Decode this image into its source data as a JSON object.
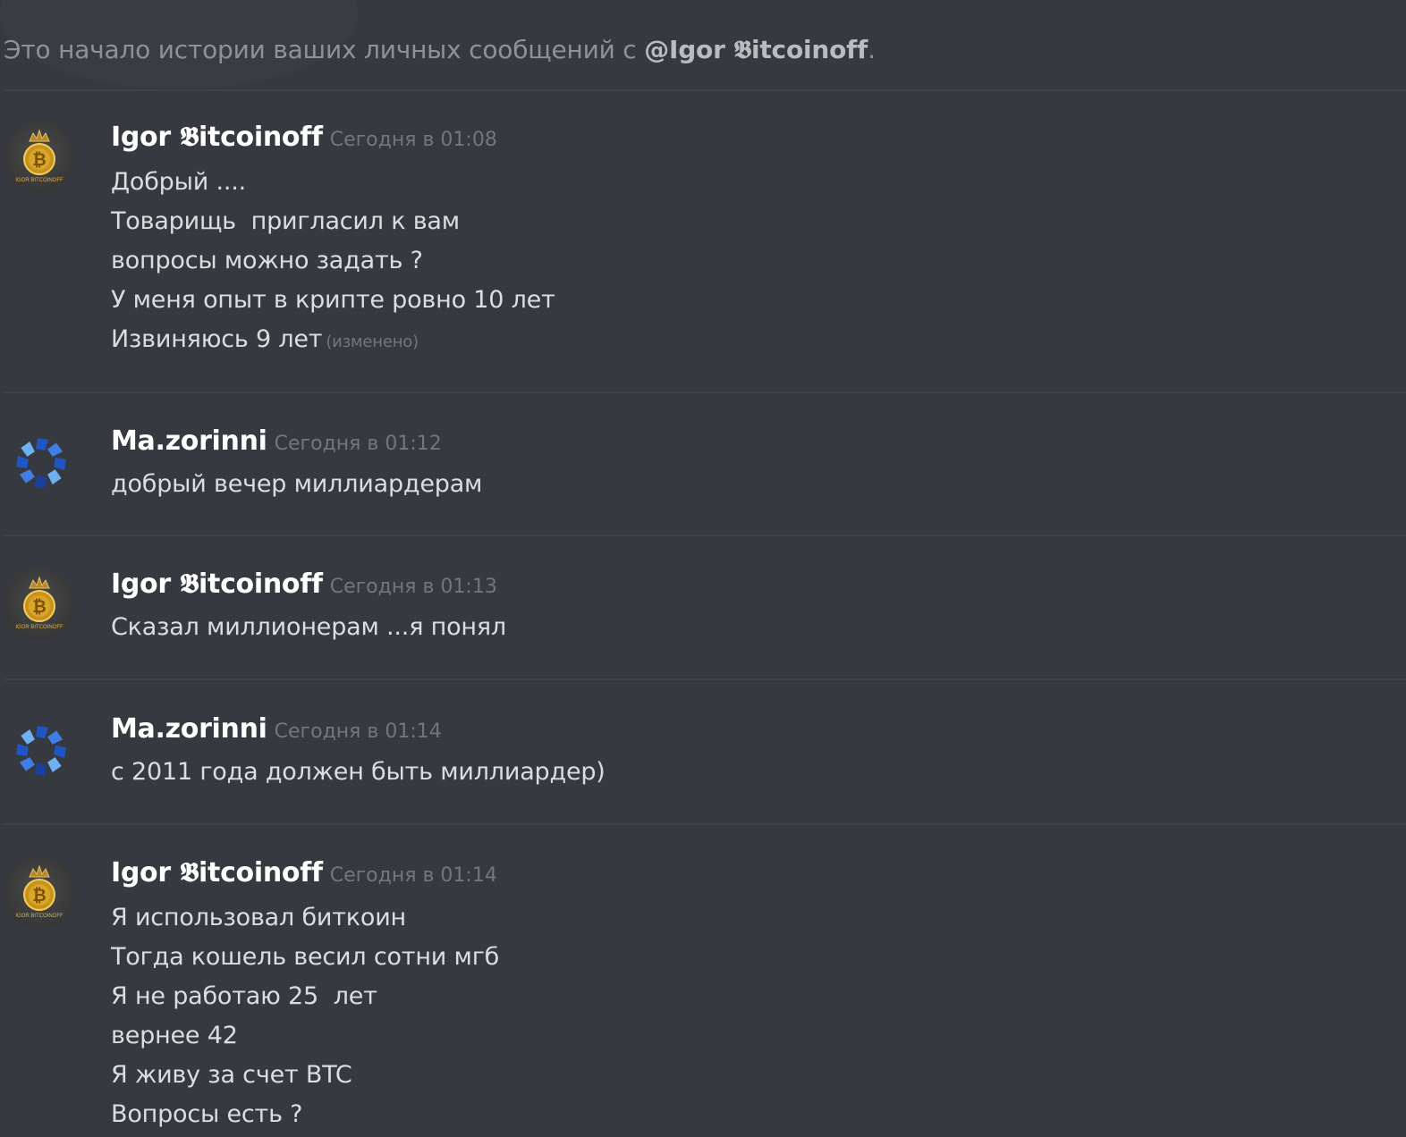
{
  "intro": {
    "text": "Это начало истории ваших личных сообщений с ",
    "mention": "@Igor 𝕭itcoinoff",
    "end": "."
  },
  "messages": [
    {
      "author": "Igor 𝕭itcoinoff",
      "time": "Сегодня в 01:08",
      "avatar": "bitcoin-crown-icon",
      "lines": [
        "Добрый ....",
        "Товарищь  пригласил к вам",
        "вопросы можно задать ?",
        "У меня опыт в крипте ровно 10 лет",
        "Извиняюсь 9 лет"
      ],
      "edited_label": "(изменено)"
    },
    {
      "author": "Ma.zorinni",
      "time": "Сегодня в 01:12",
      "avatar": "blue-star-icon",
      "lines": [
        "добрый вечер миллиардерам"
      ]
    },
    {
      "author": "Igor 𝕭itcoinoff",
      "time": "Сегодня в 01:13",
      "avatar": "bitcoin-crown-icon",
      "lines": [
        "Сказал миллионерам ...я понял"
      ]
    },
    {
      "author": "Ma.zorinni",
      "time": "Сегодня в 01:14",
      "avatar": "blue-star-icon",
      "lines": [
        "с 2011 года должен быть миллиардер)"
      ]
    },
    {
      "author": "Igor 𝕭itcoinoff",
      "time": "Сегодня в 01:14",
      "avatar": "bitcoin-crown-icon",
      "lines": [
        "Я использовал биткоин",
        "Тогда кошель весил сотни мгб",
        "Я не работаю 25  лет",
        "вернее 42",
        "Я живу за счет BTC",
        "Вопросы есть ?"
      ]
    }
  ],
  "avatar_text": "IGOR BITCOINOFF",
  "colors": {
    "background": "#36393f",
    "username": "#ffffff",
    "text": "#dcddde",
    "timestamp": "#72767d",
    "gold": "#d4a017",
    "star_blue": "#2a5cc9"
  }
}
